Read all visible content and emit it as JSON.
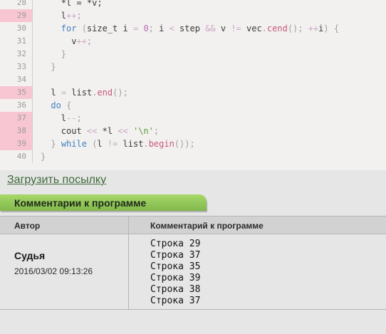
{
  "code_lines": [
    {
      "n": "28",
      "hl": false,
      "indent": 4,
      "t": [
        [
          "*l = *v;",
          ""
        ]
      ]
    },
    {
      "n": "29",
      "hl": true,
      "indent": 4,
      "t": [
        [
          "l",
          ""
        ],
        [
          "++",
          "op"
        ],
        [
          ";",
          "punc"
        ]
      ]
    },
    {
      "n": "30",
      "hl": false,
      "indent": 4,
      "t": [
        [
          "for",
          "kw"
        ],
        [
          " (",
          "punc"
        ],
        [
          "size_t i ",
          ""
        ],
        [
          "=",
          "op"
        ],
        [
          " ",
          ""
        ],
        [
          "0",
          "num"
        ],
        [
          "; ",
          "punc"
        ],
        [
          "i ",
          ""
        ],
        [
          "<",
          "op"
        ],
        [
          " step ",
          ""
        ],
        [
          "&&",
          "op"
        ],
        [
          " v ",
          ""
        ],
        [
          "!=",
          "op"
        ],
        [
          " vec",
          ""
        ],
        [
          ".",
          "punc"
        ],
        [
          "cend",
          "fn"
        ],
        [
          "(); ",
          "punc"
        ],
        [
          "++",
          "op"
        ],
        [
          "i",
          ""
        ],
        [
          ") {",
          "punc"
        ]
      ]
    },
    {
      "n": "31",
      "hl": false,
      "indent": 6,
      "t": [
        [
          "v",
          ""
        ],
        [
          "++",
          "op"
        ],
        [
          ";",
          "punc"
        ]
      ]
    },
    {
      "n": "32",
      "hl": false,
      "indent": 4,
      "t": [
        [
          "}",
          "punc"
        ]
      ]
    },
    {
      "n": "33",
      "hl": false,
      "indent": 2,
      "t": [
        [
          "}",
          "punc"
        ]
      ]
    },
    {
      "n": "34",
      "hl": false,
      "indent": 0,
      "t": []
    },
    {
      "n": "35",
      "hl": true,
      "indent": 2,
      "t": [
        [
          "l ",
          ""
        ],
        [
          "=",
          "op"
        ],
        [
          " list",
          ""
        ],
        [
          ".",
          "punc"
        ],
        [
          "end",
          "fn"
        ],
        [
          "();",
          "punc"
        ]
      ]
    },
    {
      "n": "36",
      "hl": false,
      "indent": 2,
      "t": [
        [
          "do",
          "kw"
        ],
        [
          " {",
          "punc"
        ]
      ]
    },
    {
      "n": "37",
      "hl": true,
      "indent": 4,
      "t": [
        [
          "l",
          ""
        ],
        [
          "--",
          "op"
        ],
        [
          ";",
          "punc"
        ]
      ]
    },
    {
      "n": "38",
      "hl": true,
      "indent": 4,
      "t": [
        [
          "cout ",
          ""
        ],
        [
          "<<",
          "op"
        ],
        [
          " *l ",
          ""
        ],
        [
          "<<",
          "op"
        ],
        [
          " ",
          ""
        ],
        [
          "'\\n'",
          "str"
        ],
        [
          ";",
          "punc"
        ]
      ]
    },
    {
      "n": "39",
      "hl": true,
      "indent": 2,
      "t": [
        [
          "} ",
          "punc"
        ],
        [
          "while",
          "kw"
        ],
        [
          " (",
          "punc"
        ],
        [
          "l ",
          ""
        ],
        [
          "!=",
          "op"
        ],
        [
          " list",
          ""
        ],
        [
          ".",
          "punc"
        ],
        [
          "begin",
          "fn"
        ],
        [
          "());",
          "punc"
        ]
      ]
    },
    {
      "n": "40",
      "hl": false,
      "indent": 0,
      "t": [
        [
          "}",
          "punc"
        ]
      ]
    }
  ],
  "upload_link": "Загрузить посылку",
  "section_title": "Комментарии к программе",
  "table": {
    "col_author": "Автор",
    "col_comment": "Комментарий к программе",
    "author_name": "Судья",
    "author_date": "2016/03/02 09:13:26",
    "comments": [
      "Строка 29",
      "Строка 37",
      "Строка 35",
      "Строка 39",
      "Строка 38",
      "Строка 37"
    ]
  },
  "colors": {
    "highlight": "#f8c6d2",
    "keyword": "#3d7fbf",
    "function": "#c45a7a",
    "header_green": "#96c95c"
  }
}
